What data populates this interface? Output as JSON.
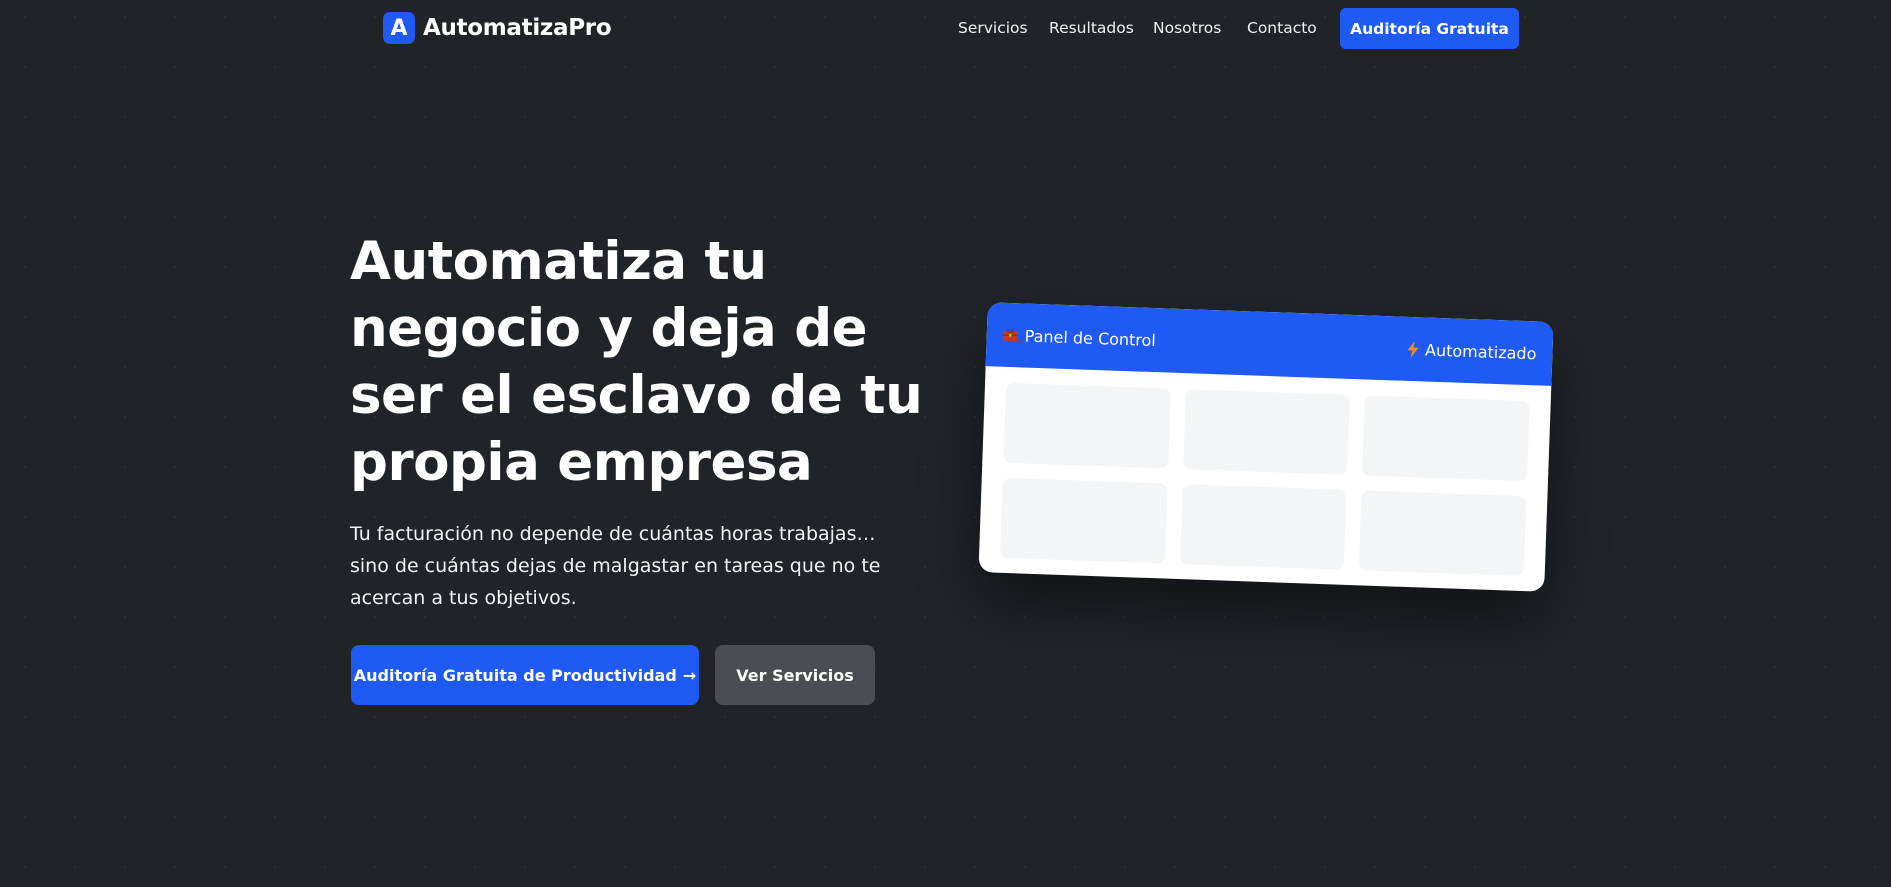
{
  "brand": {
    "logo_letter": "A",
    "name": "AutomatizaPro"
  },
  "nav": {
    "links": [
      "Servicios",
      "Resultados",
      "Nosotros",
      "Contacto"
    ],
    "cta_label": "Auditoría Gratuita"
  },
  "hero": {
    "title": "Automatiza tu negocio y deja de ser el esclavo de tu propia empresa",
    "subtitle": "Tu facturación no depende de cuántas horas trabajas… sino de cuántas dejas de malgastar en tareas que no te acercan a tus objetivos.",
    "primary_button": "Auditoría Gratuita de Productividad",
    "primary_button_arrow": "→",
    "secondary_button": "Ver Servicios"
  },
  "panel": {
    "title": "Panel de Control",
    "title_icon": "briefcase-icon",
    "status": "Automatizado",
    "status_icon": "lightning-bolt-icon"
  },
  "colors": {
    "background": "#202428",
    "accent": "#1f5af4",
    "secondary_button": "#4a4d51",
    "panel_cell": "#f4f5f7"
  }
}
